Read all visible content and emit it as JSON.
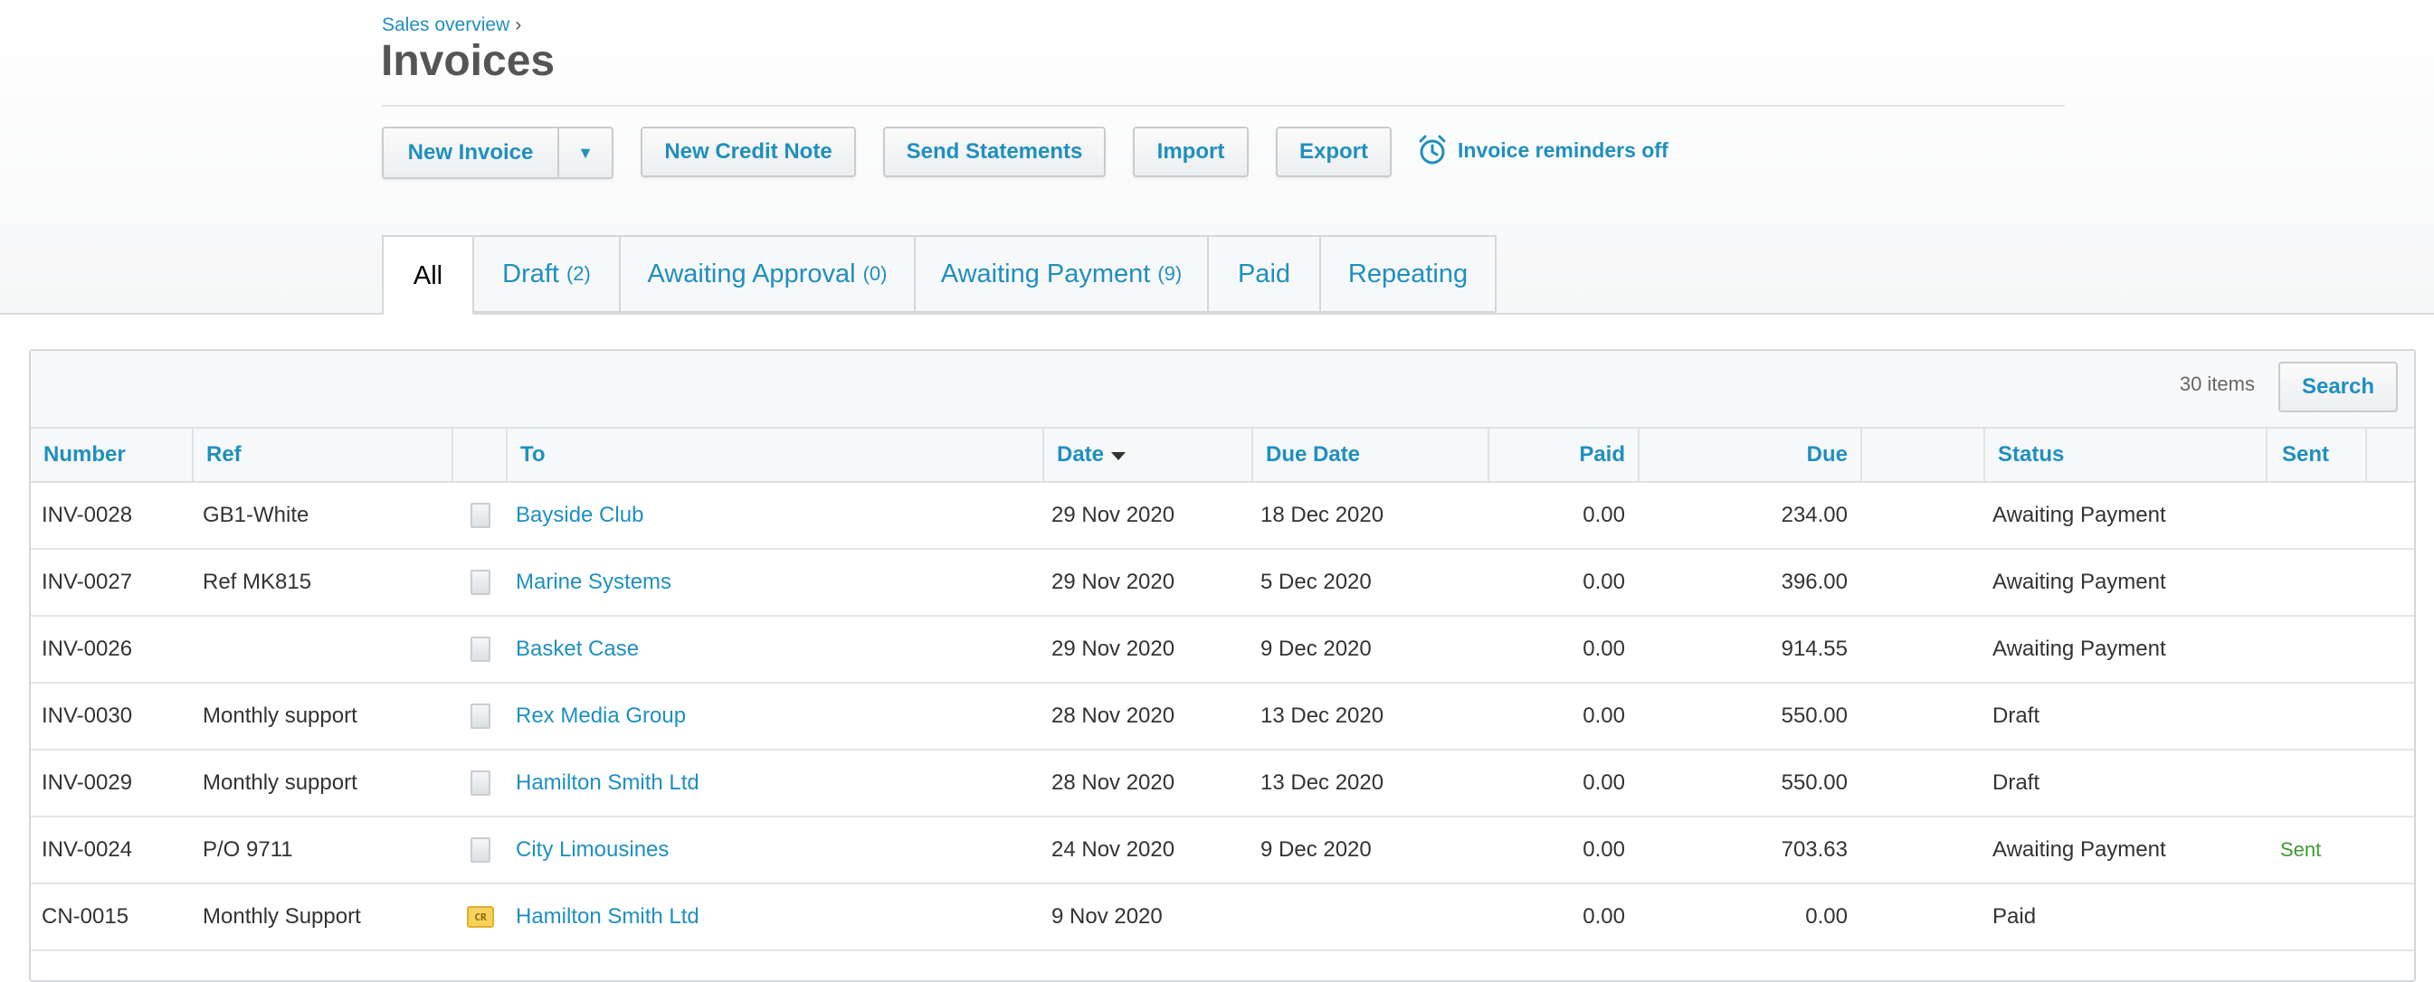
{
  "breadcrumb": {
    "parent": "Sales overview",
    "separator": "›"
  },
  "page": {
    "title": "Invoices"
  },
  "toolbar": {
    "new_invoice": "New Invoice",
    "new_credit_note": "New Credit Note",
    "send_statements": "Send Statements",
    "import": "Import",
    "export": "Export",
    "reminders": "Invoice reminders off"
  },
  "tabs": [
    {
      "label": "All",
      "count": ""
    },
    {
      "label": "Draft",
      "count": "(2)"
    },
    {
      "label": "Awaiting Approval",
      "count": "(0)"
    },
    {
      "label": "Awaiting Payment",
      "count": "(9)"
    },
    {
      "label": "Paid",
      "count": ""
    },
    {
      "label": "Repeating",
      "count": ""
    }
  ],
  "list": {
    "items_count": "30 items",
    "search_label": "Search",
    "columns": {
      "number": "Number",
      "ref": "Ref",
      "to": "To",
      "date": "Date",
      "due_date": "Due Date",
      "paid": "Paid",
      "due": "Due",
      "status": "Status",
      "sent": "Sent"
    },
    "rows": [
      {
        "number": "INV-0028",
        "ref": "GB1-White",
        "icon": "document-icon",
        "to": "Bayside Club",
        "date": "29 Nov 2020",
        "due_date": "18 Dec 2020",
        "paid": "0.00",
        "due": "234.00",
        "status": "Awaiting Payment",
        "sent": ""
      },
      {
        "number": "INV-0027",
        "ref": "Ref MK815",
        "icon": "document-icon",
        "to": "Marine Systems",
        "date": "29 Nov 2020",
        "due_date": "5 Dec 2020",
        "paid": "0.00",
        "due": "396.00",
        "status": "Awaiting Payment",
        "sent": ""
      },
      {
        "number": "INV-0026",
        "ref": "",
        "icon": "document-icon",
        "to": "Basket Case",
        "date": "29 Nov 2020",
        "due_date": "9 Dec 2020",
        "paid": "0.00",
        "due": "914.55",
        "status": "Awaiting Payment",
        "sent": ""
      },
      {
        "number": "INV-0030",
        "ref": "Monthly support",
        "icon": "document-icon",
        "to": "Rex Media Group",
        "date": "28 Nov 2020",
        "due_date": "13 Dec 2020",
        "paid": "0.00",
        "due": "550.00",
        "status": "Draft",
        "sent": ""
      },
      {
        "number": "INV-0029",
        "ref": "Monthly support",
        "icon": "document-icon",
        "to": "Hamilton Smith Ltd",
        "date": "28 Nov 2020",
        "due_date": "13 Dec 2020",
        "paid": "0.00",
        "due": "550.00",
        "status": "Draft",
        "sent": ""
      },
      {
        "number": "INV-0024",
        "ref": "P/O 9711",
        "icon": "document-icon",
        "to": "City Limousines",
        "date": "24 Nov 2020",
        "due_date": "9 Dec 2020",
        "paid": "0.00",
        "due": "703.63",
        "status": "Awaiting Payment",
        "sent": "Sent"
      },
      {
        "number": "CN-0015",
        "ref": "Monthly Support",
        "icon": "credit-note-icon",
        "icon_text": "CR",
        "to": "Hamilton Smith Ltd",
        "date": "9 Nov 2020",
        "due_date": "",
        "paid": "0.00",
        "due": "0.00",
        "status": "Paid",
        "sent": ""
      }
    ]
  },
  "colors": {
    "link": "#1f8fbf",
    "sent": "#3d9b2f",
    "cn_badge": "#f7d25a"
  }
}
